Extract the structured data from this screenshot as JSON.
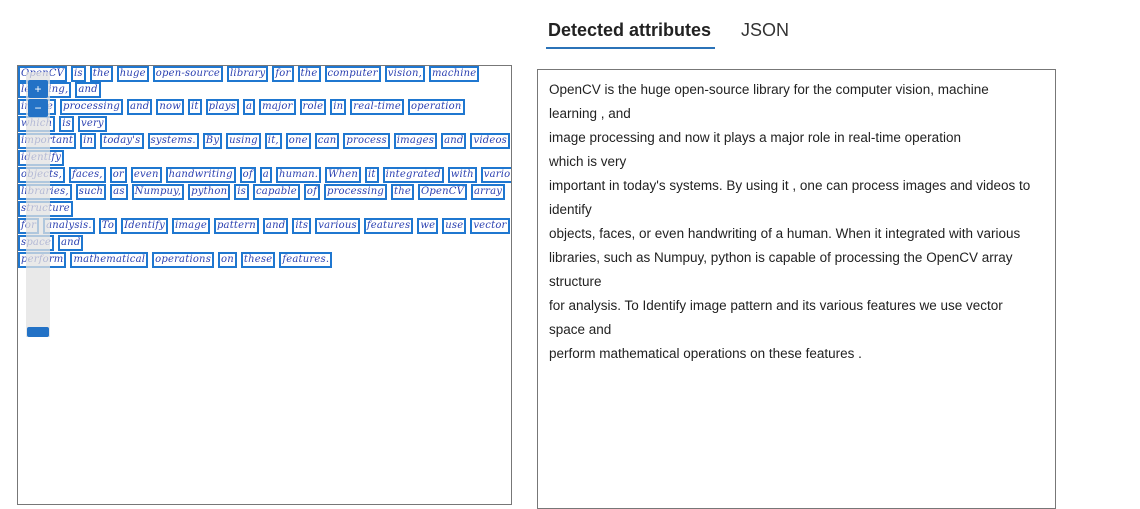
{
  "tabs": [
    {
      "label": "Detected attributes",
      "active": true
    },
    {
      "label": "JSON",
      "active": false
    }
  ],
  "colors": {
    "accent": "#2b73b8",
    "word_box": "#1f77d0"
  },
  "zoom_controls": {
    "zoom_in_icon": "plus-icon",
    "zoom_out_icon": "minus-icon"
  },
  "handwriting_lines": [
    [
      "OpenCV",
      "is",
      "the",
      "huge",
      "open-source",
      "library",
      "for",
      "the",
      "computer",
      "vision,",
      "machine"
    ],
    [
      "learning,",
      "and"
    ],
    [
      "image",
      "processing",
      "and",
      "now",
      "it",
      "plays",
      "a",
      "major",
      "role",
      "in",
      "real-time",
      "operation"
    ],
    [
      "which",
      "is",
      "very"
    ],
    [
      "important",
      "in",
      "today's",
      "systems.",
      "By",
      "using",
      "it,",
      "one",
      "can",
      "process",
      "images",
      "and",
      "videos",
      "to"
    ],
    [
      "identify"
    ],
    [
      "objects,",
      "faces,",
      "or",
      "even",
      "handwriting",
      "of",
      "a",
      "human.",
      "When",
      "it",
      "integrated",
      "with",
      "various"
    ],
    [
      "libraries,",
      "such",
      "as",
      "Numpuy,",
      "python",
      "is",
      "capable",
      "of",
      "processing",
      "the",
      "OpenCV",
      "array"
    ],
    [
      "structure"
    ],
    [
      "for",
      "analysis.",
      "To",
      "Identify",
      "image",
      "pattern",
      "and",
      "its",
      "various",
      "features",
      "we",
      "use",
      "vector"
    ],
    [
      "space",
      "and"
    ],
    [
      "perform",
      "mathematical",
      "operations",
      "on",
      "these",
      "features."
    ]
  ],
  "detected_text": [
    "OpenCV is the huge open-source library for the computer vision, machine",
    "learning , and",
    "image processing and now it plays a major role in real-time operation",
    "which is very",
    "important in today's systems. By using it , one can process images and videos to",
    "identify",
    "objects, faces, or even handwriting of a human. When it integrated with various",
    "libraries, such as Numpuy, python is capable of processing the OpenCV array",
    "structure",
    "for analysis. To Identify image pattern and its various features we use vector",
    "space and",
    "perform mathematical operations on these features ."
  ]
}
